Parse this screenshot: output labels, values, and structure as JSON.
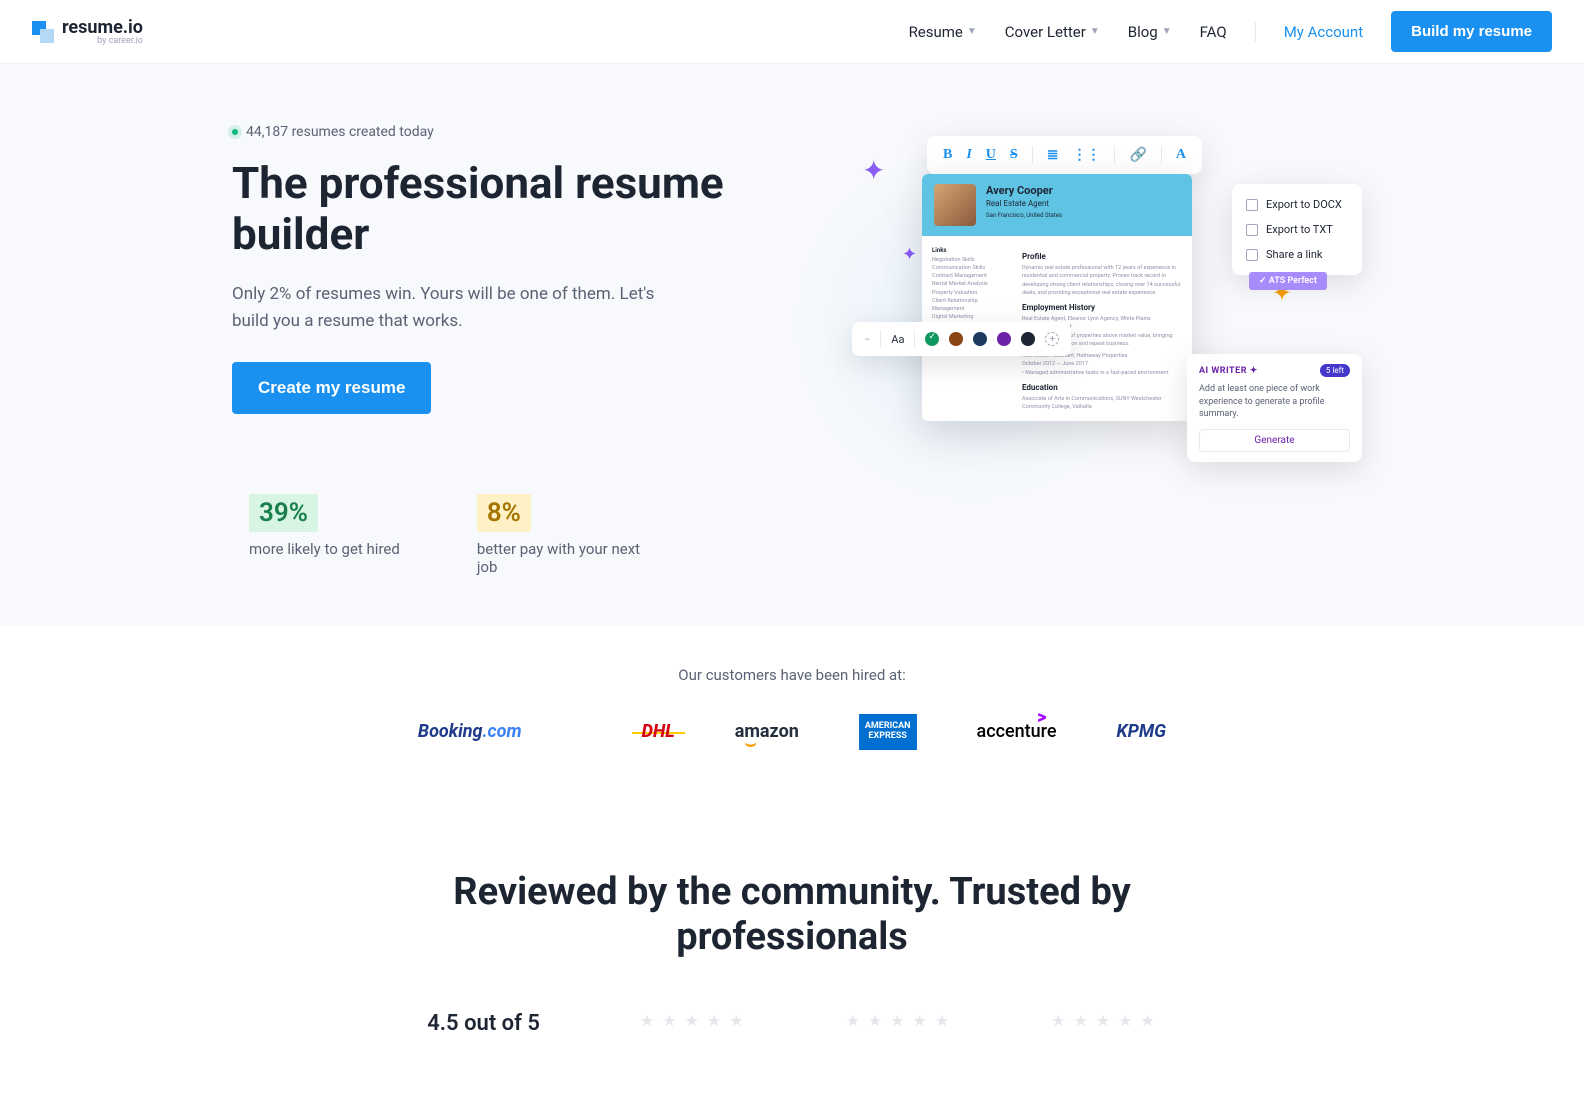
{
  "header": {
    "brand": "resume.io",
    "brand_sub": "by career.io",
    "nav": {
      "resume": "Resume",
      "cover_letter": "Cover Letter",
      "blog": "Blog",
      "faq": "FAQ",
      "account": "My Account",
      "build_btn": "Build my resume"
    }
  },
  "hero": {
    "counter": "44,187 resumes created today",
    "title": "The professional resume builder",
    "subtitle": "Only 2% of resumes win. Yours will be one of them. Let's build you a resume that works.",
    "cta": "Create my resume",
    "stats": [
      {
        "value": "39%",
        "desc": "more likely to get hired"
      },
      {
        "value": "8%",
        "desc": "better pay with your next job"
      }
    ]
  },
  "preview": {
    "toolbar": {
      "b": "B",
      "i": "I",
      "u": "U",
      "s": "S"
    },
    "name": "Avery Cooper",
    "role": "Real Estate Agent",
    "contact": "San Francisco, United States",
    "side_label": "Links",
    "profile_h": "Profile",
    "emp_h": "Employment History",
    "edu_h": "Education",
    "export": {
      "docx": "Export to DOCX",
      "txt": "Export to TXT",
      "share": "Share a link"
    },
    "ats": "✓ ATS Perfect",
    "font_label": "Aa",
    "ai": {
      "title": "AI WRITER ✦",
      "badge": "5 left",
      "text": "Add at least one piece of work experience to generate a profile summary.",
      "btn": "Generate"
    }
  },
  "customers": {
    "title": "Our customers have been hired at:",
    "logos": {
      "booking_a": "Booking",
      "booking_b": ".com",
      "dhl": "DHL",
      "amazon": "amazon",
      "amex_a": "AMERICAN",
      "amex_b": "EXPRESS",
      "accenture": "accenture",
      "kpmg": "KPMG"
    }
  },
  "reviews": {
    "title": "Reviewed by the community. Trusted by professionals",
    "score": "4.5 out of 5"
  }
}
